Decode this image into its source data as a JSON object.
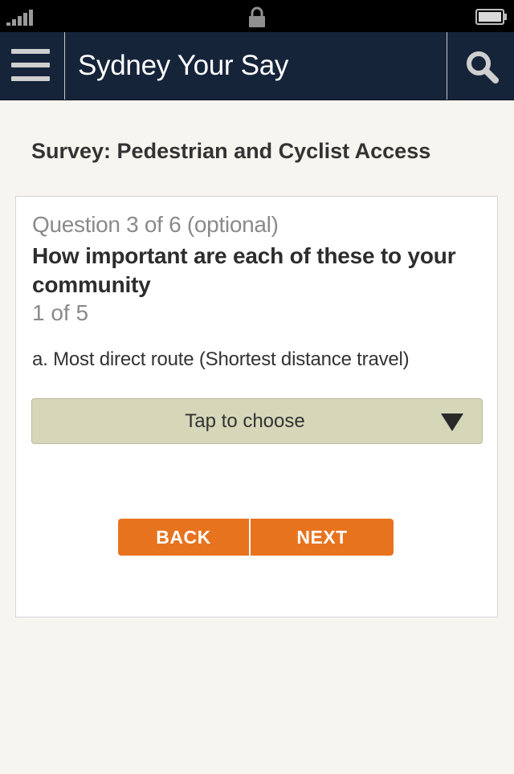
{
  "status_bar": {
    "signal_icon": "signal-bars-icon",
    "lock_icon": "lock-icon",
    "battery_icon": "battery-icon"
  },
  "header": {
    "title": "Sydney Your Say",
    "menu_icon": "hamburger-menu-icon",
    "search_icon": "search-icon",
    "background_color": "#16243a"
  },
  "survey": {
    "title": "Survey: Pedestrian and Cyclist Access"
  },
  "question": {
    "number_label": "Question 3 of 6 (optional)",
    "text": "How important are each of these to your community",
    "progress": "1 of 5",
    "item": "a. Most direct route (Shortest distance travel)",
    "select_placeholder": "Tap to choose",
    "select_icon": "dropdown-arrow-icon",
    "select_color": "#d6d7b8"
  },
  "navigation": {
    "back_label": "BACK",
    "next_label": "NEXT",
    "button_color": "#e8731f"
  }
}
